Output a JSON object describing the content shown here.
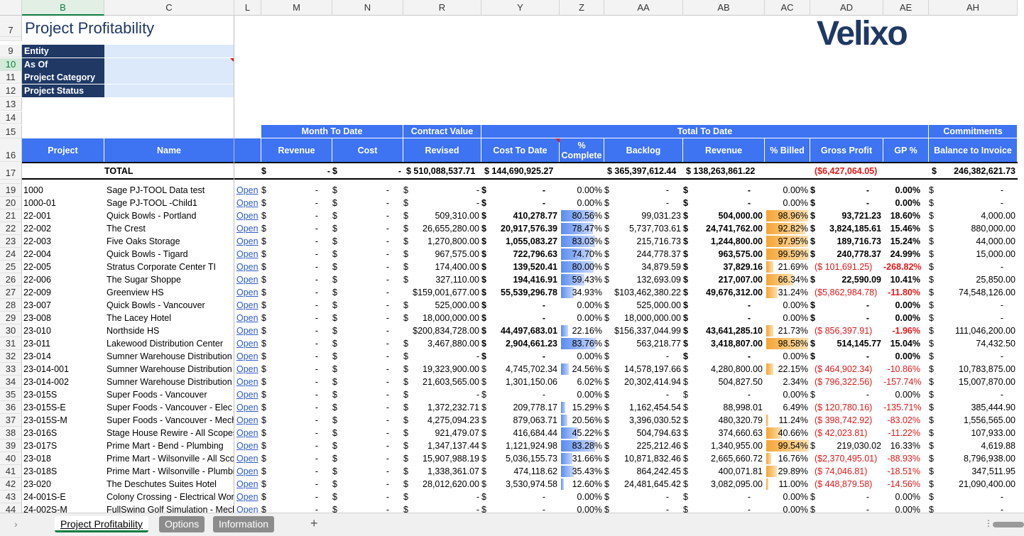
{
  "columns": [
    {
      "letter": "B",
      "w": 116
    },
    {
      "letter": "C",
      "w": 183
    },
    {
      "letter": "L",
      "w": 38
    },
    {
      "letter": "M",
      "w": 100
    },
    {
      "letter": "N",
      "w": 100
    },
    {
      "letter": "R",
      "w": 110
    },
    {
      "letter": "Y",
      "w": 110
    },
    {
      "letter": "Z",
      "w": 63
    },
    {
      "letter": "AA",
      "w": 111
    },
    {
      "letter": "AB",
      "w": 115
    },
    {
      "letter": "AC",
      "w": 64
    },
    {
      "letter": "AD",
      "w": 103
    },
    {
      "letter": "AE",
      "w": 64
    },
    {
      "letter": "AH",
      "w": 125
    }
  ],
  "title": "Project Profitability",
  "logo": "Velixo",
  "filters": [
    {
      "row": "9",
      "label": "Entity",
      "value": ""
    },
    {
      "row": "10",
      "label": "As Of",
      "value": ""
    },
    {
      "row": "11",
      "label": "Project Category",
      "value": ""
    },
    {
      "row": "12",
      "label": "Project Status",
      "value": ""
    }
  ],
  "header_groups": {
    "mtd": "Month To Date",
    "contract": "Contract Value",
    "ttd": "Total To Date",
    "commit": "Commitments"
  },
  "headers": {
    "project": "Project",
    "name": "Name",
    "revenue": "Revenue",
    "cost": "Cost",
    "revised": "Revised",
    "cost_to_date": "Cost To Date",
    "pct_complete": "% Complete",
    "backlog": "Backlog",
    "ttd_revenue": "Revenue",
    "pct_billed": "% Billed",
    "gross_profit": "Gross Profit",
    "gp_pct": "GP %",
    "balance": "Balance to Invoice"
  },
  "total": {
    "label": "TOTAL",
    "mtd_rev": "-",
    "mtd_cost": "-",
    "revised": "$ 510,088,537.71",
    "cost_to_date": "$ 144,690,925.27",
    "backlog": "$ 365,397,612.44",
    "revenue": "$ 138,263,861.22",
    "gross_profit": "($6,427,064.05)",
    "balance": "246,382,621.73"
  },
  "rows": [
    {
      "r": "19",
      "p": "1000",
      "n": "Sage PJ-TOOL Data test",
      "rev": "-",
      "cost": "-",
      "rv": "-",
      "ctd": "-",
      "pc": "0.00%",
      "pcv": 0,
      "bl": "-",
      "tr": "-",
      "pb": "0.00%",
      "pbv": 0,
      "gp": "-",
      "gpp": "0.00%",
      "bal": "-",
      "bold": true,
      "neg": false
    },
    {
      "r": "20",
      "p": "1000-01",
      "n": "Sage PJ-TOOL -Child1",
      "rev": "-",
      "cost": "-",
      "rv": "-",
      "ctd": "-",
      "pc": "0.00%",
      "pcv": 0,
      "bl": "-",
      "tr": "-",
      "pb": "0.00%",
      "pbv": 0,
      "gp": "-",
      "gpp": "0.00%",
      "bal": "-",
      "bold": true,
      "neg": false
    },
    {
      "r": "21",
      "p": "22-001",
      "n": "Quick Bowls - Portland",
      "rev": "-",
      "cost": "-",
      "rv": "509,310.00",
      "ctd": "410,278.77",
      "pc": "80.56%",
      "pcv": 80.56,
      "bl": "99,031.23",
      "tr": "504,000.00",
      "pb": "98.96%",
      "pbv": 98.96,
      "gp": "93,721.23",
      "gpp": "18.60%",
      "bal": "4,000.00",
      "bold": true,
      "neg": false
    },
    {
      "r": "22",
      "p": "22-002",
      "n": "The Crest",
      "rev": "-",
      "cost": "-",
      "rv": "26,655,280.00",
      "ctd": "20,917,576.39",
      "pc": "78.47%",
      "pcv": 78.47,
      "bl": "5,737,703.61",
      "tr": "24,741,762.00",
      "pb": "92.82%",
      "pbv": 92.82,
      "gp": "3,824,185.61",
      "gpp": "15.46%",
      "bal": "880,000.00",
      "bold": true,
      "neg": false
    },
    {
      "r": "23",
      "p": "22-003",
      "n": "Five Oaks Storage",
      "rev": "-",
      "cost": "-",
      "rv": "1,270,800.00",
      "ctd": "1,055,083.27",
      "pc": "83.03%",
      "pcv": 83.03,
      "bl": "215,716.73",
      "tr": "1,244,800.00",
      "pb": "97.95%",
      "pbv": 97.95,
      "gp": "189,716.73",
      "gpp": "15.24%",
      "bal": "44,000.00",
      "bold": true,
      "neg": false
    },
    {
      "r": "24",
      "p": "22-004",
      "n": "Quick Bowls - Tigard",
      "rev": "-",
      "cost": "-",
      "rv": "967,575.00",
      "ctd": "722,796.63",
      "pc": "74.70%",
      "pcv": 74.7,
      "bl": "244,778.37",
      "tr": "963,575.00",
      "pb": "99.59%",
      "pbv": 99.59,
      "gp": "240,778.37",
      "gpp": "24.99%",
      "bal": "15,000.00",
      "bold": true,
      "neg": false
    },
    {
      "r": "25",
      "p": "22-005",
      "n": "Stratus Corporate Center TI",
      "rev": "-",
      "cost": "-",
      "rv": "174,400.00",
      "ctd": "139,520.41",
      "pc": "80.00%",
      "pcv": 80,
      "bl": "34,879.59",
      "tr": "37,829.16",
      "pb": "21.69%",
      "pbv": 21.69,
      "gp": "($ 101,691.25)",
      "gpp": "-268.82%",
      "bal": "-",
      "bold": true,
      "neg": true
    },
    {
      "r": "26",
      "p": "22-006",
      "n": "The Sugar Shoppe",
      "rev": "-",
      "cost": "-",
      "rv": "327,110.00",
      "ctd": "194,416.91",
      "pc": "59.43%",
      "pcv": 59.43,
      "bl": "132,693.09",
      "tr": "217,007.00",
      "pb": "66.34%",
      "pbv": 66.34,
      "gp": "22,590.09",
      "gpp": "10.41%",
      "bal": "25,850.00",
      "bold": true,
      "neg": false
    },
    {
      "r": "27",
      "p": "22-009",
      "n": "Greenview HS",
      "rev": "-",
      "cost": "-",
      "rv": "$159,001,677.00",
      "ctd": "55,539,296.78",
      "pc": "34.93%",
      "pcv": 34.93,
      "bl": "$103,462,380.22",
      "tr": "49,676,312.00",
      "pb": "31.24%",
      "pbv": 31.24,
      "gp": "($5,862,984.78)",
      "gpp": "-11.80%",
      "bal": "74,548,126.00",
      "bold": true,
      "neg": true
    },
    {
      "r": "28",
      "p": "23-007",
      "n": "Quick Bowls - Vancouver",
      "rev": "-",
      "cost": "-",
      "rv": "525,000.00",
      "ctd": "-",
      "pc": "0.00%",
      "pcv": 0,
      "bl": "525,000.00",
      "tr": "-",
      "pb": "0.00%",
      "pbv": 0,
      "gp": "-",
      "gpp": "0.00%",
      "bal": "-",
      "bold": true,
      "neg": false
    },
    {
      "r": "29",
      "p": "23-008",
      "n": "The Lacey Hotel",
      "rev": "-",
      "cost": "-",
      "rv": "18,000,000.00",
      "ctd": "-",
      "pc": "0.00%",
      "pcv": 0,
      "bl": "18,000,000.00",
      "tr": "-",
      "pb": "0.00%",
      "pbv": 0,
      "gp": "-",
      "gpp": "0.00%",
      "bal": "-",
      "bold": true,
      "neg": false
    },
    {
      "r": "30",
      "p": "23-010",
      "n": "Northside HS",
      "rev": "-",
      "cost": "-",
      "rv": "$200,834,728.00",
      "ctd": "44,497,683.01",
      "pc": "22.16%",
      "pcv": 22.16,
      "bl": "$156,337,044.99",
      "tr": "43,641,285.10",
      "pb": "21.73%",
      "pbv": 21.73,
      "gp": "($ 856,397.91)",
      "gpp": "-1.96%",
      "bal": "111,046,200.00",
      "bold": true,
      "neg": true
    },
    {
      "r": "31",
      "p": "23-011",
      "n": "Lakewood Distribution Center",
      "rev": "-",
      "cost": "-",
      "rv": "3,467,880.00",
      "ctd": "2,904,661.23",
      "pc": "83.76%",
      "pcv": 83.76,
      "bl": "563,218.77",
      "tr": "3,418,807.00",
      "pb": "98.58%",
      "pbv": 98.58,
      "gp": "514,145.77",
      "gpp": "15.04%",
      "bal": "74,432.50",
      "bold": true,
      "neg": false
    },
    {
      "r": "32",
      "p": "23-014",
      "n": "Sumner Warehouse Distribution",
      "rev": "-",
      "cost": "-",
      "rv": "-",
      "ctd": "-",
      "pc": "0.00%",
      "pcv": 0,
      "bl": "-",
      "tr": "-",
      "pb": "0.00%",
      "pbv": 0,
      "gp": "-",
      "gpp": "0.00%",
      "bal": "-",
      "bold": true,
      "neg": false
    },
    {
      "r": "33",
      "p": "23-014-001",
      "n": "Sumner Warehouse Distribution",
      "rev": "-",
      "cost": "-",
      "rv": "19,323,900.00",
      "ctd": "4,745,702.34",
      "pc": "24.56%",
      "pcv": 24.56,
      "bl": "14,578,197.66",
      "tr": "4,280,800.00",
      "pb": "22.15%",
      "pbv": 22.15,
      "gp": "($ 464,902.34)",
      "gpp": "-10.86%",
      "bal": "10,783,875.00",
      "bold": false,
      "neg": true
    },
    {
      "r": "34",
      "p": "23-014-002",
      "n": "Sumner Warehouse Distribution",
      "rev": "-",
      "cost": "-",
      "rv": "21,603,565.00",
      "ctd": "1,301,150.06",
      "pc": "6.02%",
      "pcv": 6.02,
      "bl": "20,302,414.94",
      "tr": "504,827.50",
      "pb": "2.34%",
      "pbv": 2.34,
      "gp": "($ 796,322.56)",
      "gpp": "-157.74%",
      "bal": "15,007,870.00",
      "bold": false,
      "neg": true
    },
    {
      "r": "35",
      "p": "23-015S",
      "n": "Super Foods - Vancouver",
      "rev": "-",
      "cost": "-",
      "rv": "-",
      "ctd": "-",
      "pc": "0.00%",
      "pcv": 0,
      "bl": "-",
      "tr": "-",
      "pb": "0.00%",
      "pbv": 0,
      "gp": "-",
      "gpp": "0.00%",
      "bal": "-",
      "bold": false,
      "neg": false
    },
    {
      "r": "36",
      "p": "23-015S-E",
      "n": "Super Foods - Vancouver - Elec -",
      "rev": "-",
      "cost": "-",
      "rv": "1,372,232.71",
      "ctd": "209,778.17",
      "pc": "15.29%",
      "pcv": 15.29,
      "bl": "1,162,454.54",
      "tr": "88,998.01",
      "pb": "6.49%",
      "pbv": 6.49,
      "gp": "($ 120,780.16)",
      "gpp": "-135.71%",
      "bal": "385,444.90",
      "bold": false,
      "neg": true
    },
    {
      "r": "37",
      "p": "23-015S-M",
      "n": "Super Foods - Vancouver - Mech",
      "rev": "-",
      "cost": "-",
      "rv": "4,275,094.23",
      "ctd": "879,063.71",
      "pc": "20.56%",
      "pcv": 20.56,
      "bl": "3,396,030.52",
      "tr": "480,320.79",
      "pb": "11.24%",
      "pbv": 11.24,
      "gp": "($ 398,742.92)",
      "gpp": "-83.02%",
      "bal": "1,556,565.00",
      "bold": false,
      "neg": true
    },
    {
      "r": "38",
      "p": "23-016S",
      "n": "Stage House Rewire - All Scopes",
      "rev": "-",
      "cost": "-",
      "rv": "921,479.07",
      "ctd": "416,684.44",
      "pc": "45.22%",
      "pcv": 45.22,
      "bl": "504,794.63",
      "tr": "374,660.63",
      "pb": "40.66%",
      "pbv": 40.66,
      "gp": "($ 42,023.81)",
      "gpp": "-11.22%",
      "bal": "107,933.00",
      "bold": false,
      "neg": true
    },
    {
      "r": "39",
      "p": "23-017S",
      "n": "Prime Mart - Bend - Plumbing",
      "rev": "-",
      "cost": "-",
      "rv": "1,347,137.44",
      "ctd": "1,121,924.98",
      "pc": "83.28%",
      "pcv": 83.28,
      "bl": "225,212.46",
      "tr": "1,340,955.00",
      "pb": "99.54%",
      "pbv": 99.54,
      "gp": "219,030.02",
      "gpp": "16.33%",
      "bal": "4,619.88",
      "bold": false,
      "neg": false
    },
    {
      "r": "40",
      "p": "23-018",
      "n": "Prime Mart - Wilsonville - All Sco",
      "rev": "-",
      "cost": "-",
      "rv": "15,907,988.19",
      "ctd": "5,036,155.73",
      "pc": "31.66%",
      "pcv": 31.66,
      "bl": "10,871,832.46",
      "tr": "2,665,660.72",
      "pb": "16.76%",
      "pbv": 16.76,
      "gp": "($2,370,495.01)",
      "gpp": "-88.93%",
      "bal": "8,796,938.00",
      "bold": false,
      "neg": true
    },
    {
      "r": "41",
      "p": "23-018S",
      "n": "Prime Mart - Wilsonville - Plumbi",
      "rev": "-",
      "cost": "-",
      "rv": "1,338,361.07",
      "ctd": "474,118.62",
      "pc": "35.43%",
      "pcv": 35.43,
      "bl": "864,242.45",
      "tr": "400,071.81",
      "pb": "29.89%",
      "pbv": 29.89,
      "gp": "($ 74,046.81)",
      "gpp": "-18.51%",
      "bal": "347,511.95",
      "bold": false,
      "neg": true
    },
    {
      "r": "42",
      "p": "23-020",
      "n": "The Deschutes Suites Hotel",
      "rev": "-",
      "cost": "-",
      "rv": "28,012,620.00",
      "ctd": "3,530,974.58",
      "pc": "12.60%",
      "pcv": 12.6,
      "bl": "24,481,645.42",
      "tr": "3,082,095.00",
      "pb": "11.00%",
      "pbv": 11,
      "gp": "($ 448,879.58)",
      "gpp": "-14.56%",
      "bal": "21,090,400.00",
      "bold": false,
      "neg": true
    },
    {
      "r": "43",
      "p": "24-001S-E",
      "n": "Colony Crossing - Electrical Worl",
      "rev": "-",
      "cost": "-",
      "rv": "-",
      "ctd": "-",
      "pc": "0.00%",
      "pcv": 0,
      "bl": "-",
      "tr": "-",
      "pb": "0.00%",
      "pbv": 0,
      "gp": "-",
      "gpp": "0.00%",
      "bal": "-",
      "bold": false,
      "neg": false
    },
    {
      "r": "44",
      "p": "24-002S-M",
      "n": "FullSwing Golf Simulation - Mech",
      "rev": "-",
      "cost": "-",
      "rv": "-",
      "ctd": "-",
      "pc": "0.00%",
      "pcv": 0,
      "bl": "-",
      "tr": "-",
      "pb": "0.00%",
      "pbv": 0,
      "gp": "-",
      "gpp": "0.00%",
      "bal": "-",
      "bold": false,
      "neg": false
    }
  ],
  "open_label": "Open",
  "dollar": "$",
  "tabs": [
    "Project Profitability",
    "Options",
    "Information"
  ],
  "add_sheet": "+",
  "colors": {
    "navy": "#1f3864",
    "header_blue": "#3e73f2",
    "bar_blue": "#5b8cf0",
    "bar_orange": "#f4a533",
    "negative": "#e01919"
  }
}
